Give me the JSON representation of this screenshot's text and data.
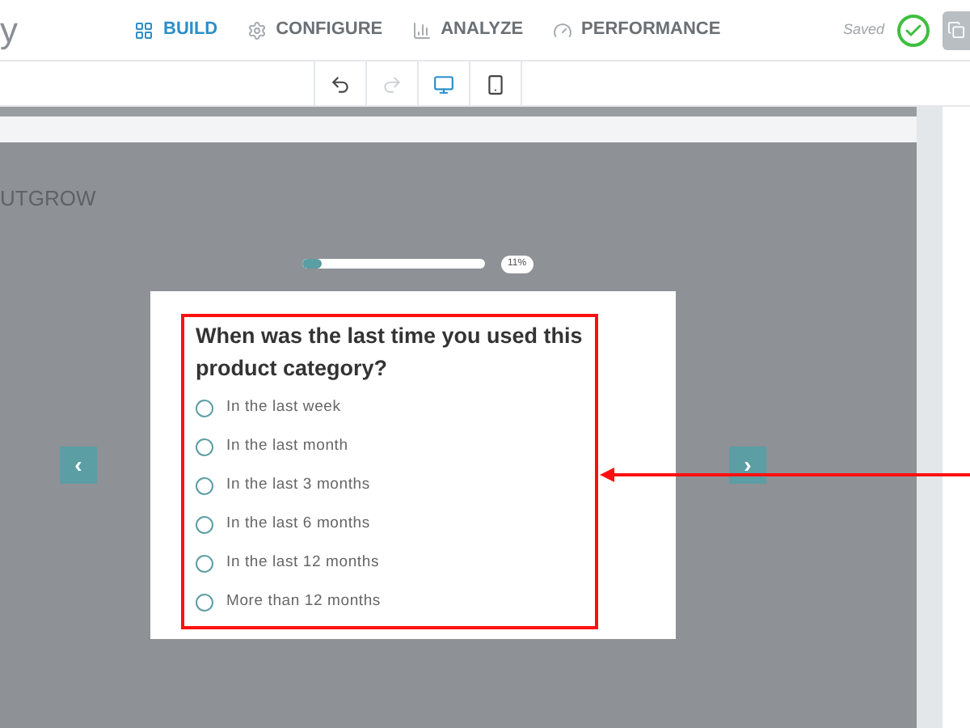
{
  "logo": "y",
  "nav": [
    {
      "label": "BUILD",
      "selected": true
    },
    {
      "label": "CONFIGURE",
      "selected": false
    },
    {
      "label": "ANALYZE",
      "selected": false
    },
    {
      "label": "PERFORMANCE",
      "selected": false
    }
  ],
  "save_status": "Saved",
  "toolbar": [
    {
      "selected": false
    },
    {
      "selected": false
    },
    {
      "selected": true
    },
    {
      "selected": false
    }
  ],
  "brand": "UTGROW",
  "progress": {
    "level": 0.11,
    "reading": "11%"
  },
  "question": "When was the last time you used this product category?",
  "options": [
    {
      "label": "In the last week",
      "selected": false
    },
    {
      "label": "In the last month",
      "selected": false
    },
    {
      "label": "In the last 3 months",
      "selected": false
    },
    {
      "label": "In the last 6 months",
      "selected": false
    },
    {
      "label": "In the last 12 months",
      "selected": false
    },
    {
      "label": "More than 12 months",
      "selected": false
    }
  ],
  "prev_button": "‹",
  "next_button": "›"
}
